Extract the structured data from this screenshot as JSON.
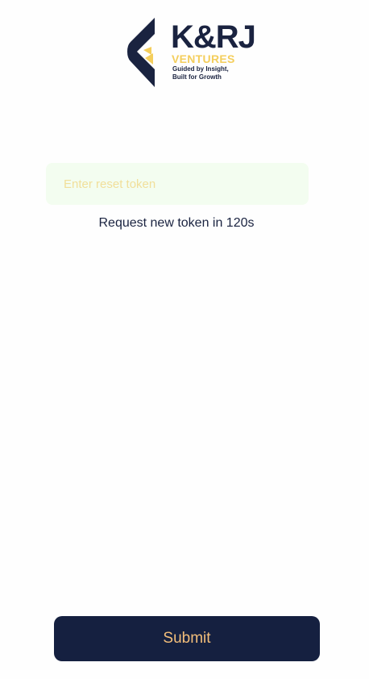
{
  "brand": {
    "name": "K&RJ",
    "sub": "VENTURES",
    "tagline_line1": "Guided by Insight,",
    "tagline_line2": "Built for Growth"
  },
  "form": {
    "token_placeholder": "Enter reset token",
    "token_value": "",
    "resend_text": "Request new token in 120s",
    "submit_label": "Submit"
  },
  "colors": {
    "navy": "#152040",
    "gold": "#f4ce5c",
    "submit_text": "#f3be7a",
    "input_bg": "#f3fdf0",
    "placeholder": "#f1df9a"
  }
}
